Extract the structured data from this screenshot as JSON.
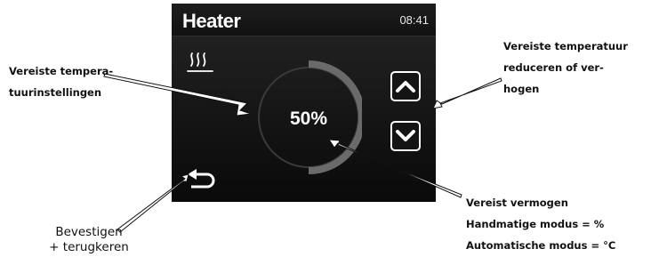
{
  "screen": {
    "title": "Heater",
    "clock": "08:41",
    "gauge": {
      "label": "50%",
      "level": 0.5
    },
    "icons": {
      "heat": "heating-waves-icon",
      "up": "chevron-up-icon",
      "down": "chevron-down-icon",
      "back": "back-return-arrow-icon"
    },
    "colors": {
      "accent": "#ffffff",
      "ring": "#6a6a6a",
      "ring_track": "#3a3a3a",
      "background": "#141414"
    }
  },
  "annotations": {
    "required_temp_settings": [
      "Vereiste tempera-",
      "tuurinstellingen"
    ],
    "reduce_or_raise": [
      "Vereiste temperatuur",
      "reduceren of ver-",
      "hogen"
    ],
    "power": [
      "Vereist vermogen",
      "Handmatige modus = %",
      "Automatische modus = °C"
    ],
    "confirm_return": [
      "Bevestigen",
      "+ terugkeren"
    ]
  }
}
